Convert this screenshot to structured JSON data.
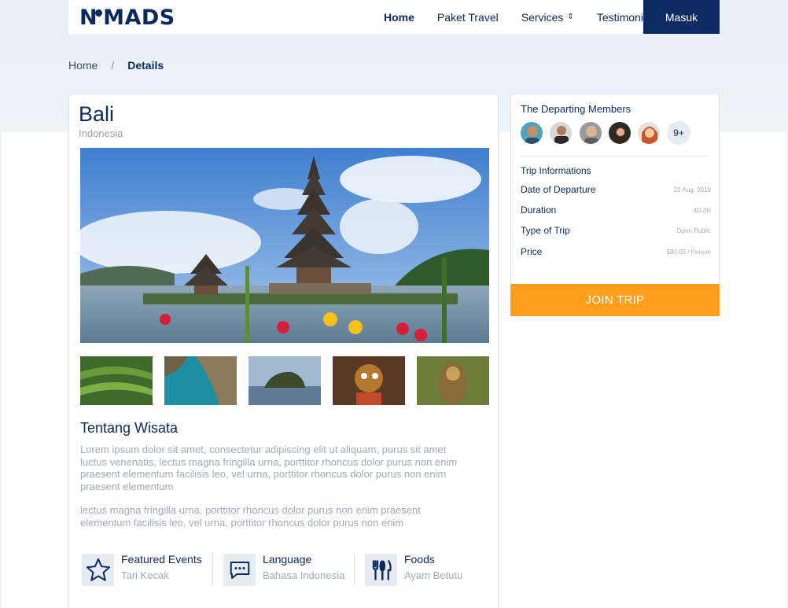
{
  "brand": {
    "logo_text_left": "N",
    "logo_text_right": "MADS"
  },
  "nav": {
    "links": [
      {
        "label": "Home"
      },
      {
        "label": "Paket Travel"
      },
      {
        "label": "Services"
      },
      {
        "label": "Testimonials"
      }
    ],
    "login_label": "Masuk"
  },
  "breadcrumb": {
    "home": "Home",
    "separator": "/",
    "current": "Details"
  },
  "destination": {
    "title": "Bali",
    "country": "Indonesia"
  },
  "about": {
    "title": "Tentang Wisata",
    "paragraph1": "Lorem ipsum dolor sit amet, consectetur adipiscing elit ut aliquam, purus sit amet luctus venenatis, lectus magna fringilla urna, porttitor rhoncus dolor purus non enim praesent elementum facilisis leo, vel urna, porttitor rhoncus dolor purus non enim praesent elementum",
    "paragraph2": "lectus magna fringilla urna, porttitor rhoncus dolor purus non enim praesent elementum facilisis leo, vel urna, porttitor rhoncus dolor purus non enim"
  },
  "features": [
    {
      "title": "Featured Events",
      "value": "Tari Kecak",
      "icon": "star-icon"
    },
    {
      "title": "Language",
      "value": "Bahasa Indonesia",
      "icon": "chat-icon"
    },
    {
      "title": "Foods",
      "value": "Ayam Betutu",
      "icon": "utensils-icon"
    }
  ],
  "members": {
    "title": "The Departing Members",
    "more_label": "9+"
  },
  "trip_info": {
    "title": "Trip Informations",
    "rows": [
      {
        "label": "Date of Departure",
        "value": "22 Aug, 2019"
      },
      {
        "label": "Duration",
        "value": "4D 3N"
      },
      {
        "label": "Type of Trip",
        "value": "Open Public"
      },
      {
        "label": "Price",
        "value": "$80,00 / Person"
      }
    ]
  },
  "join_label": "JOIN TRIP",
  "colors": {
    "primary": "#0e2b61",
    "accent": "#ff9e1b",
    "muted": "#a4abb8"
  }
}
